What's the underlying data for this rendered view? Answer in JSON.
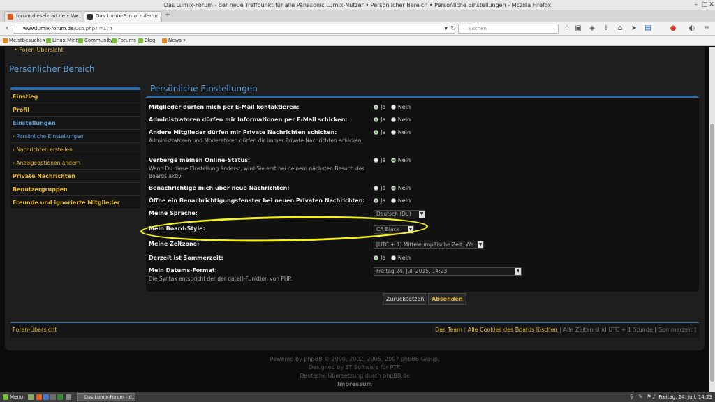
{
  "window": {
    "title": "Das Lumix-Forum - der neue Treffpunkt für alle Panasonic Lumix-Nutzer • Persönlicher Bereich • Persönliche Einstellungen - Mozilla Firefox"
  },
  "tabs": [
    {
      "label": "forum.dieselzrad.de • We...",
      "color": "#e05a1e"
    },
    {
      "label": "Das Lumix-Forum - der n...",
      "color": "#333333"
    }
  ],
  "url": {
    "host": "www.lumix-forum.de",
    "path": "/ucp.php?i=174"
  },
  "search": {
    "placeholder": "Suchen"
  },
  "bookmarks": [
    {
      "label": "Meistbesucht ▾",
      "color": "#e08a1e"
    },
    {
      "label": "Linux Mint",
      "color": "#7dbf3c"
    },
    {
      "label": "Community",
      "color": "#7dbf3c"
    },
    {
      "label": "Forums",
      "color": "#7dbf3c"
    },
    {
      "label": "Blog",
      "color": "#7dbf3c"
    },
    {
      "label": "News ▾",
      "color": "#e08a1e"
    }
  ],
  "page": {
    "crumb_top": "• Foren-Übersicht",
    "section_title": "Persönlicher Bereich",
    "main_title": "Persönliche Einstellungen"
  },
  "sidebar": [
    {
      "label": "Einstieg",
      "sub": false,
      "active": false
    },
    {
      "label": "Profil",
      "sub": false,
      "active": false
    },
    {
      "label": "Einstellungen",
      "sub": false,
      "active": true
    },
    {
      "label": "Persönliche Einstellungen",
      "sub": true,
      "active": true
    },
    {
      "label": "Nachrichten erstellen",
      "sub": true,
      "active": false
    },
    {
      "label": "Anzeigeoptionen ändern",
      "sub": true,
      "active": false
    },
    {
      "label": "Private Nachrichten",
      "sub": false,
      "active": false
    },
    {
      "label": "Benutzergruppen",
      "sub": false,
      "active": false
    },
    {
      "label": "Freunde und ignorierte Mitglieder",
      "sub": false,
      "active": false
    }
  ],
  "options": {
    "yes": "Ja",
    "no": "Nein"
  },
  "settings": [
    {
      "label": "Mitglieder dürfen mich per E-Mail kontaktieren:",
      "desc": "",
      "type": "radio",
      "value": "yes"
    },
    {
      "label": "Administratoren dürfen mir Informationen per E-Mail schicken:",
      "desc": "",
      "type": "radio",
      "value": "yes"
    },
    {
      "label": "Andere Mitglieder dürfen mir Private Nachrichten schicken:",
      "desc": "Administratoren und Moderatoren dürfen dir immer Private Nachrichten schicken.",
      "type": "radio",
      "value": "yes"
    },
    {
      "label": "Verberge meinen Online-Status:",
      "desc": "Wenn Du diese Einstellung änderst, wird Sie erst bei deinem nächsten Besuch des Boards aktiv.",
      "type": "radio",
      "value": "no"
    },
    {
      "label": "Benachrichtige mich über neue Nachrichten:",
      "desc": "",
      "type": "radio",
      "value": "no"
    },
    {
      "label": "Öffne ein Benachrichtigungsfenster bei neuen Privaten Nachrichten:",
      "desc": "",
      "type": "radio",
      "value": "yes"
    },
    {
      "label": "Meine Sprache:",
      "desc": "",
      "type": "select",
      "value": "Deutsch (Du)"
    },
    {
      "label": "Mein Board-Style:",
      "desc": "",
      "type": "select",
      "value": "CA Black"
    },
    {
      "label": "Meine Zeitzone:",
      "desc": "",
      "type": "select",
      "value": "[UTC + 1] Mitteleuropäische Zeit, We"
    },
    {
      "label": "Derzeit ist Sommerzeit:",
      "desc": "",
      "type": "radio",
      "value": "yes"
    },
    {
      "label": "Mein Datums-Format:",
      "desc": "Die Syntax entspricht der der date()-Funktion von PHP.",
      "type": "select",
      "value": "Freitag 24. Juli 2015, 14:23"
    }
  ],
  "buttons": {
    "reset": "Zurücksetzen",
    "submit": "Absenden"
  },
  "footer": {
    "left": "Foren-Übersicht",
    "team": "Das Team",
    "cookies": "Alle Cookies des Boards löschen",
    "tz": "Alle Zeiten sind UTC + 1 Stunde [ Sommerzeit ]"
  },
  "credits": [
    "Powered by phpBB © 2000, 2002, 2005, 2007 phpBB Group.",
    "Designed by ST Software for PTF.",
    "Deutsche Übersetzung durch phpBB.de"
  ],
  "impressum": "Impressum",
  "taskbar": {
    "menu": "Menu",
    "task": "Das Lumix-Forum - d...",
    "clock": "Freitag, 24. Juli, 14:23"
  }
}
